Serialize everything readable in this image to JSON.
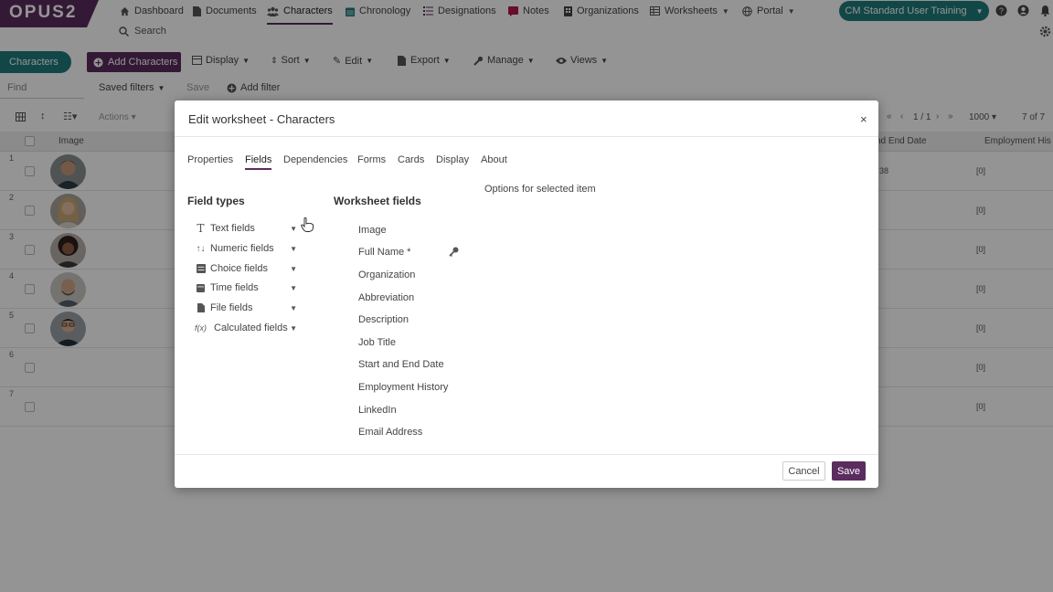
{
  "brand": {
    "logo_text": "OPUS2",
    "primary_color": "#5b2c5e",
    "accent_color": "#1f7a7a"
  },
  "topnav": {
    "items": [
      {
        "label": "Dashboard",
        "icon": "home-icon"
      },
      {
        "label": "Documents",
        "icon": "document-icon"
      },
      {
        "label": "Characters",
        "icon": "people-icon",
        "active": true
      },
      {
        "label": "Chronology",
        "icon": "calendar-icon"
      },
      {
        "label": "Designations",
        "icon": "list-icon"
      },
      {
        "label": "Notes",
        "icon": "note-icon"
      },
      {
        "label": "Organizations",
        "icon": "building-icon"
      },
      {
        "label": "Worksheets",
        "icon": "table-icon"
      },
      {
        "label": "Portal",
        "icon": "globe-icon"
      }
    ],
    "search_label": "Search",
    "user_button": "CM Standard User Training"
  },
  "toolbar": {
    "view_chip": "Characters",
    "add_button": "Add Characters",
    "items": [
      "Display",
      "Sort",
      "Edit",
      "Export",
      "Manage",
      "Views"
    ]
  },
  "filters": {
    "find_placeholder": "Find",
    "saved_filters": "Saved filters",
    "save": "Save",
    "add_filter": "Add filter"
  },
  "grid": {
    "actions_label": "Actions",
    "pagination": "1 / 1",
    "page_size": "1000",
    "count": "7 of 7",
    "columns": [
      "Image",
      "nd End Date",
      "Employment His"
    ],
    "rows": [
      {
        "num": "1",
        "partial_date": "38",
        "history": "[0]"
      },
      {
        "num": "2",
        "history": "[0]"
      },
      {
        "num": "3",
        "history": "[0]"
      },
      {
        "num": "4",
        "history": "[0]"
      },
      {
        "num": "5",
        "history": "[0]"
      },
      {
        "num": "6",
        "history": "[0]"
      },
      {
        "num": "7",
        "history": "[0]"
      }
    ]
  },
  "modal": {
    "title": "Edit worksheet - Characters",
    "close_symbol": "×",
    "tabs": [
      "Properties",
      "Fields",
      "Dependencies",
      "Forms",
      "Cards",
      "Display",
      "About"
    ],
    "active_tab": "Fields",
    "field_types_heading": "Field types",
    "worksheet_fields_heading": "Worksheet fields",
    "options_text": "Options for selected item",
    "field_types": [
      {
        "label": "Text fields",
        "icon": "text-icon"
      },
      {
        "label": "Numeric fields",
        "icon": "numeric-icon"
      },
      {
        "label": "Choice fields",
        "icon": "choice-icon"
      },
      {
        "label": "Time fields",
        "icon": "calendar-icon"
      },
      {
        "label": "File fields",
        "icon": "file-icon"
      },
      {
        "label": "Calculated fields",
        "icon": "function-icon"
      }
    ],
    "worksheet_fields": [
      "Image",
      "Full Name *",
      "Organization",
      "Abbreviation",
      "Description",
      "Job Title",
      "Start and End Date",
      "Employment History",
      "LinkedIn",
      "Email Address"
    ],
    "cancel_label": "Cancel",
    "save_label": "Save"
  }
}
